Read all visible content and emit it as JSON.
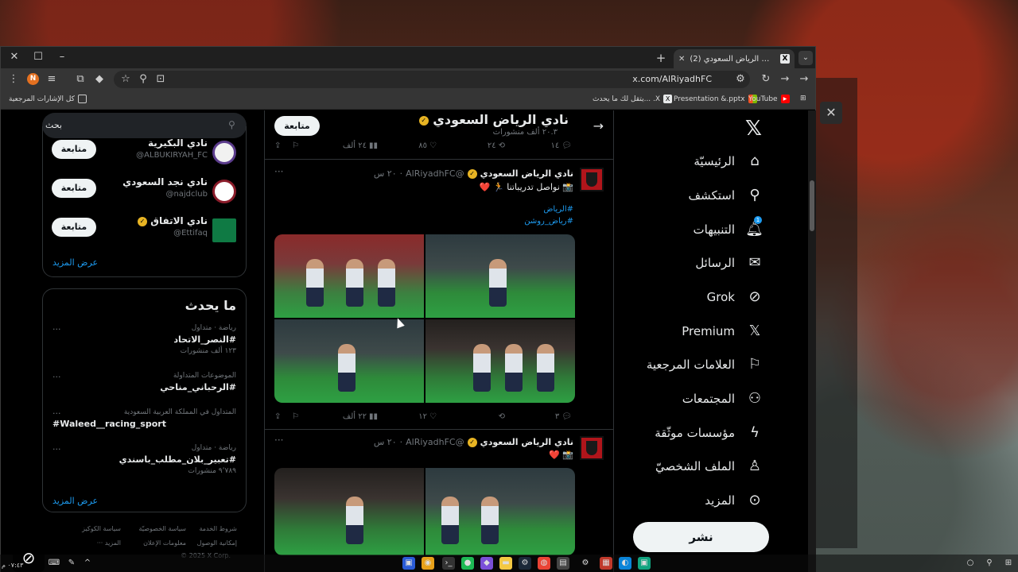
{
  "browser": {
    "tab_title": "(2) نادي الرياض السعودي (@AlRiyadhFC",
    "tab_icon": "x-logo-icon",
    "url": "x.com/AlRiyadhFC",
    "avatar_letter": "N",
    "bookmarks": [
      "YouTube",
      "Presentation &.pptx",
      "يتقل لك ما يحدث... .X"
    ],
    "bookmarks_folder": "كل الإشارات المرجعية"
  },
  "nav": {
    "items": [
      {
        "label": "الرئيسيّة",
        "icon": "home-icon"
      },
      {
        "label": "استكشف",
        "icon": "search-icon"
      },
      {
        "label": "التنبيهات",
        "icon": "bell-icon",
        "badge": "1"
      },
      {
        "label": "الرسائل",
        "icon": "mail-icon"
      },
      {
        "label": "Grok",
        "icon": "grok-icon"
      },
      {
        "label": "Premium",
        "icon": "x-logo-icon"
      },
      {
        "label": "العلامات المرجعية",
        "icon": "bookmark-icon"
      },
      {
        "label": "المجتمعات",
        "icon": "communities-icon"
      },
      {
        "label": "مؤسسات موثّقة",
        "icon": "lightning-icon"
      },
      {
        "label": "الملف الشخصيّ",
        "icon": "person-icon"
      },
      {
        "label": "المزيد",
        "icon": "more-circle-icon"
      }
    ],
    "post_label": "نشر"
  },
  "profile": {
    "name": "نادي الرياض السعودي",
    "posts_count": "٢٠.٣ ألف منشورات",
    "follow_label": "متابعة",
    "actions": {
      "replies": "١٤",
      "reposts": "٢٤",
      "likes": "٨٥",
      "views": "٢٤ ألف"
    }
  },
  "tweets": [
    {
      "name": "نادي الرياض السعودي",
      "handle": "@AlRiyadhFC",
      "time": "٢٠ س",
      "text": "📸 نواصل تدريباتنا 🏃 ❤️",
      "hashtags": [
        "#الرياض",
        "#رياض_روشن"
      ],
      "actions": {
        "replies": "٣",
        "reposts": "",
        "likes": "١٢",
        "views": "٢٢ ألف"
      }
    },
    {
      "name": "نادي الرياض السعودي",
      "handle": "@AlRiyadhFC",
      "time": "٢٠ س",
      "text": "📸 ❤️"
    }
  ],
  "sidebar": {
    "search_placeholder": "بحث",
    "who_to_follow": [
      {
        "name": "نادي البكيرية",
        "handle": "@ALBUKIRYAH_FC",
        "follow": "متابعة",
        "verified": false
      },
      {
        "name": "نادي نجد السعودي",
        "handle": "@najdclub",
        "follow": "متابعة",
        "verified": false
      },
      {
        "name": "نادي الاتفاق",
        "handle": "@Ettifaq",
        "follow": "متابعة",
        "verified": true
      }
    ],
    "show_more": "عرض المزيد",
    "trends_title": "ما يحدث",
    "trends": [
      {
        "category": "رياضة · متداول",
        "name": "#النصر_الاتحاد",
        "count": "١٢٣ ألف منشورات"
      },
      {
        "category": "الموضوعات المتداولة",
        "name": "#الرحباني_مناحي",
        "count": ""
      },
      {
        "category": "المتداول في المملكة العربية السعودية",
        "name": "#Waleed__racing_sport",
        "count": ""
      },
      {
        "category": "رياضة · متداول",
        "name": "#تعبير_بلان_مطلب_باسندي",
        "count": "٩٬٧٨٩ منشورات"
      }
    ],
    "trends_more": "عرض المزيد",
    "footer": {
      "terms": "شروط الخدمة",
      "privacy": "سياسة الخصوصيّة",
      "cookies": "سياسة الكوكيز",
      "accessibility": "إمكانية الوصول",
      "ads": "معلومات الإعلان",
      "more": "المزيد ···",
      "copyright": "© 2025 X Corp."
    }
  },
  "taskbar": {
    "clock": "٠٧:٤٣ م"
  }
}
